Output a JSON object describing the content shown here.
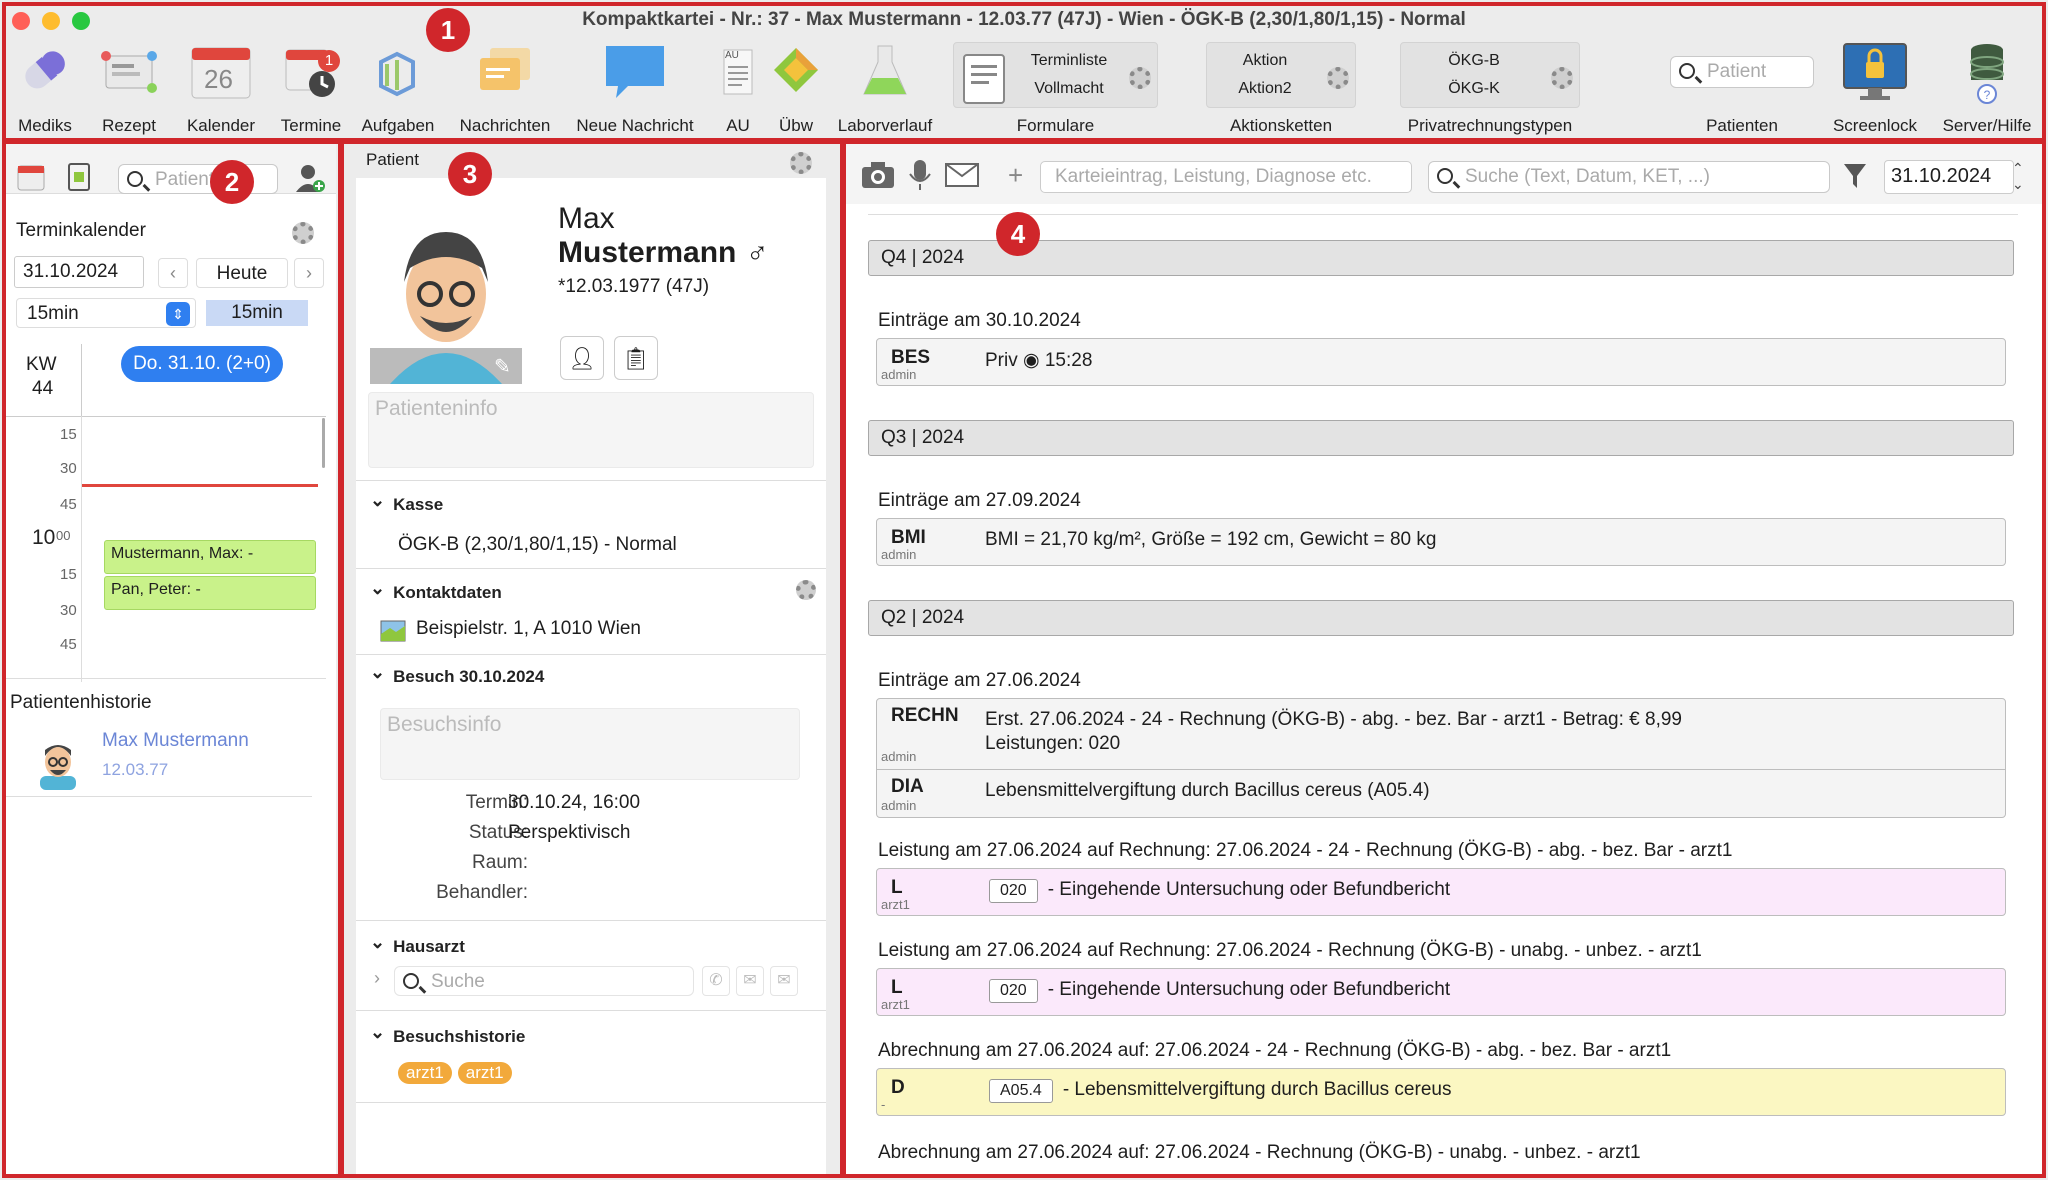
{
  "window": {
    "title": "Kompaktkartei - Nr.: 37 - Max Mustermann - 12.03.77 (47J) - Wien - ÖGK-B (2,30/1,80/1,15) - Normal"
  },
  "toolbar": {
    "mediks": "Mediks",
    "rezept": "Rezept",
    "kalender": "Kalender",
    "kalender_day": "26",
    "termine": "Termine",
    "termine_badge": "1",
    "aufgaben": "Aufgaben",
    "nachrichten": "Nachrichten",
    "neue_nachricht": "Neue Nachricht",
    "au": "AU",
    "au_small": "AU",
    "uebw": "Übw",
    "laborverlauf": "Laborverlauf",
    "formulare": {
      "label": "Formulare",
      "line1": "Terminliste",
      "line2": "Vollmacht"
    },
    "aktionsketten": {
      "label": "Aktionsketten",
      "line1": "Aktion",
      "line2": "Aktion2"
    },
    "privatrechnung": {
      "label": "Privatrechnungstypen",
      "line1": "ÖKG-B",
      "line2": "ÖKG-K"
    },
    "patient_search_placeholder": "Patient",
    "patienten": "Patienten",
    "screenlock": "Screenlock",
    "server_hilfe": "Server/Hilfe"
  },
  "markers": [
    "1",
    "2",
    "3",
    "4"
  ],
  "left": {
    "search_placeholder": "Patient",
    "title": "Terminkalender",
    "date": "31.10.2024",
    "today": "Heute",
    "interval_select": "15min",
    "interval_chip": "15min",
    "kw_label": "KW",
    "kw_num": "44",
    "day_pill": "Do. 31.10. (2+0)",
    "times": [
      "15",
      "30",
      "45",
      "10",
      "15",
      "30",
      "45"
    ],
    "time_super": "00",
    "appointments": [
      "Mustermann, Max:  -",
      "Pan, Peter:  -"
    ],
    "history_title": "Patientenhistorie",
    "history_name": "Max Mustermann",
    "history_date": "12.03.77"
  },
  "patient": {
    "header": "Patient",
    "first": "Max",
    "last": "Mustermann",
    "gender": "♂",
    "dob": "*12.03.1977 (47J)",
    "info_placeholder": "Patienteninfo",
    "kasse_title": "Kasse",
    "kasse_value": "ÖGK-B (2,30/1,80/1,15) - Normal",
    "kontakt_title": "Kontaktdaten",
    "address": "Beispielstr. 1, A 1010 Wien",
    "besuch_title": "Besuch 30.10.2024",
    "besuch_placeholder": "Besuchsinfo",
    "termin_label": "Termin:",
    "termin_value": "30.10.24, 16:00",
    "status_label": "Status:",
    "status_value": "Perspektivisch",
    "raum_label": "Raum:",
    "behandler_label": "Behandler:",
    "hausarzt_title": "Hausarzt",
    "hausarzt_placeholder": "Suche",
    "historie_title": "Besuchshistorie",
    "historie_tags": [
      "arzt1",
      "arzt1"
    ]
  },
  "chart": {
    "entry_placeholder": "Karteieintrag, Leistung, Diagnose etc.",
    "search_placeholder": "Suche (Text, Datum, KET, ...)",
    "date": "31.10.2024",
    "q4": "Q4 | 2024",
    "q4_day": "Einträge am 30.10.2024",
    "bes_code": "BES",
    "bes_user": "admin",
    "bes_text": "Priv ◉ 15:28",
    "q3": "Q3 | 2024",
    "q3_day": "Einträge am 27.09.2024",
    "bmi_code": "BMI",
    "bmi_user": "admin",
    "bmi_text": "BMI = 21,70 kg/m², Größe = 192 cm, Gewicht = 80 kg",
    "q2": "Q2 | 2024",
    "q2_day": "Einträge am 27.06.2024",
    "rechn_code": "RECHN",
    "rechn_user": "admin",
    "rechn_line1": "Erst. 27.06.2024 - 24 - Rechnung (ÖKG-B) - abg. - bez. Bar - arzt1 - Betrag: € 8,99",
    "rechn_line2": "Leistungen: 020",
    "dia_code": "DIA",
    "dia_user": "admin",
    "dia_text": "Lebensmittelvergiftung durch Bacillus cereus (A05.4)",
    "leist1_title": "Leistung am 27.06.2024 auf Rechnung: 27.06.2024 - 24 - Rechnung (ÖKG-B) - abg. - bez. Bar - arzt1",
    "l1_code": "L",
    "l1_user": "arzt1",
    "l1_badge": "020",
    "l1_text": "- Eingehende Untersuchung oder Befundbericht",
    "leist2_title": "Leistung am 27.06.2024 auf Rechnung: 27.06.2024 - Rechnung (ÖKG-B) - unabg. - unbez. - arzt1",
    "l2_code": "L",
    "l2_user": "arzt1",
    "l2_badge": "020",
    "l2_text": "- Eingehende Untersuchung oder Befundbericht",
    "abr1_title": "Abrechnung am 27.06.2024 auf: 27.06.2024 - 24 - Rechnung (ÖKG-B) - abg. - bez. Bar - arzt1",
    "d_code": "D",
    "d_user": "-",
    "d_badge": "A05.4",
    "d_text": "- Lebensmittelvergiftung durch Bacillus cereus",
    "abr2_title": "Abrechnung am 27.06.2024 auf: 27.06.2024 - Rechnung (ÖKG-B) - unabg. - unbez. - arzt1"
  },
  "colors": {
    "marker": "#d0262b",
    "appointment": "#c9f28a",
    "leistung": "#fbe9fb",
    "diagnose": "#fbf7c2",
    "link": "#6b86d6",
    "pill": "#2f7ff0"
  }
}
